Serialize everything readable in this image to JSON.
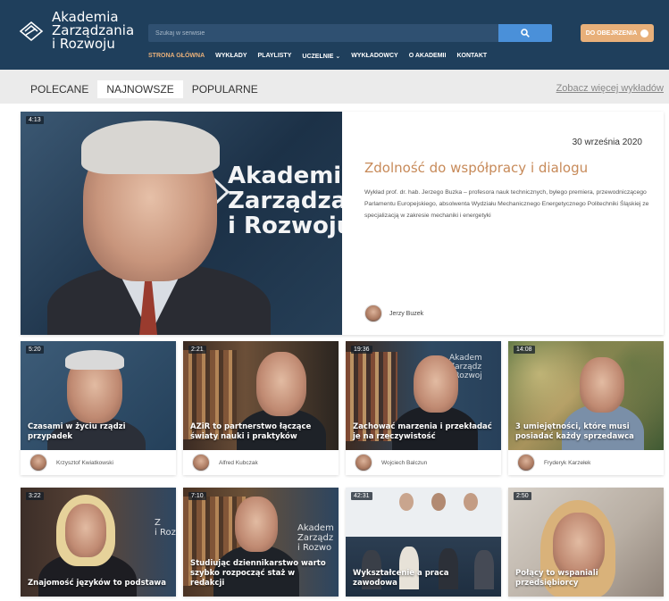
{
  "header": {
    "logo_lines": [
      "Akademia",
      "Zarządzania",
      "i Rozwoju"
    ],
    "search_placeholder": "Szukaj w serwisie",
    "watch_label": "DO OBEJRZENIA",
    "nav": [
      "STRONA GŁÓWNA",
      "WYKŁADY",
      "PLAYLISTY",
      "UCZELNIE ⌄",
      "WYKŁADOWCY",
      "O AKADEMII",
      "KONTAKT"
    ],
    "active_nav_index": 0,
    "colors": {
      "bg": "#1f3f5c",
      "accent": "#e8b07a",
      "search_button": "#4a90d9"
    }
  },
  "tabs": {
    "items": [
      "POLECANE",
      "NAJNOWSZE",
      "POPULARNE"
    ],
    "active_index": 1,
    "more_link": "Zobacz więcej wykładów"
  },
  "featured": {
    "duration": "4:13",
    "brand_lines": [
      "Akademia",
      "Zarządzar",
      "i Rozwoju"
    ],
    "date": "30 września 2020",
    "title": "Zdolność do współpracy i dialogu",
    "description": "Wykład prof. dr. hab. Jerzego Buzka – profesora nauk technicznych, byłego premiera, przewodniczącego Parlamentu Europejskiego, absolwenta Wydziału Mechanicznego Energetycznego Politechniki Śląskiej ze specjalizacją w zakresie mechaniki i energetyki",
    "author": "Jerzy Buzek"
  },
  "cards": [
    {
      "duration": "5:20",
      "title": "Czasami w życiu rządzi przypadek",
      "author": "Krzysztof Kwiatkowski"
    },
    {
      "duration": "2:21",
      "title": "AZiR to partnerstwo łączące światy nauki i praktyków",
      "author": "Alfred Kubczak"
    },
    {
      "duration": "19:36",
      "title": "Zachować marzenia i przekładać je na rzeczywistość",
      "author": "Wojciech Balczun",
      "brand_lines": [
        "Akadem",
        "Zarządz",
        "i Rozwoj"
      ]
    },
    {
      "duration": "14:08",
      "title": "3 umiejętności, które musi posiadać każdy sprzedawca",
      "author": "Fryderyk Karzełek"
    },
    {
      "duration": "3:22",
      "title": "Znajomość języków to podstawa",
      "brand_lines": [
        "Z",
        "i Roz"
      ]
    },
    {
      "duration": "7:10",
      "title": "Studiując dziennikarstwo warto szybko rozpocząć staż w redakcji",
      "brand_lines": [
        "Akadem",
        "Zarządz",
        "i Rozwo"
      ]
    },
    {
      "duration": "42:31",
      "title": "Wykształcenie a praca zawodowa"
    },
    {
      "duration": "2:50",
      "title": "Połący to wspaniali przedsiębiorcy"
    }
  ]
}
